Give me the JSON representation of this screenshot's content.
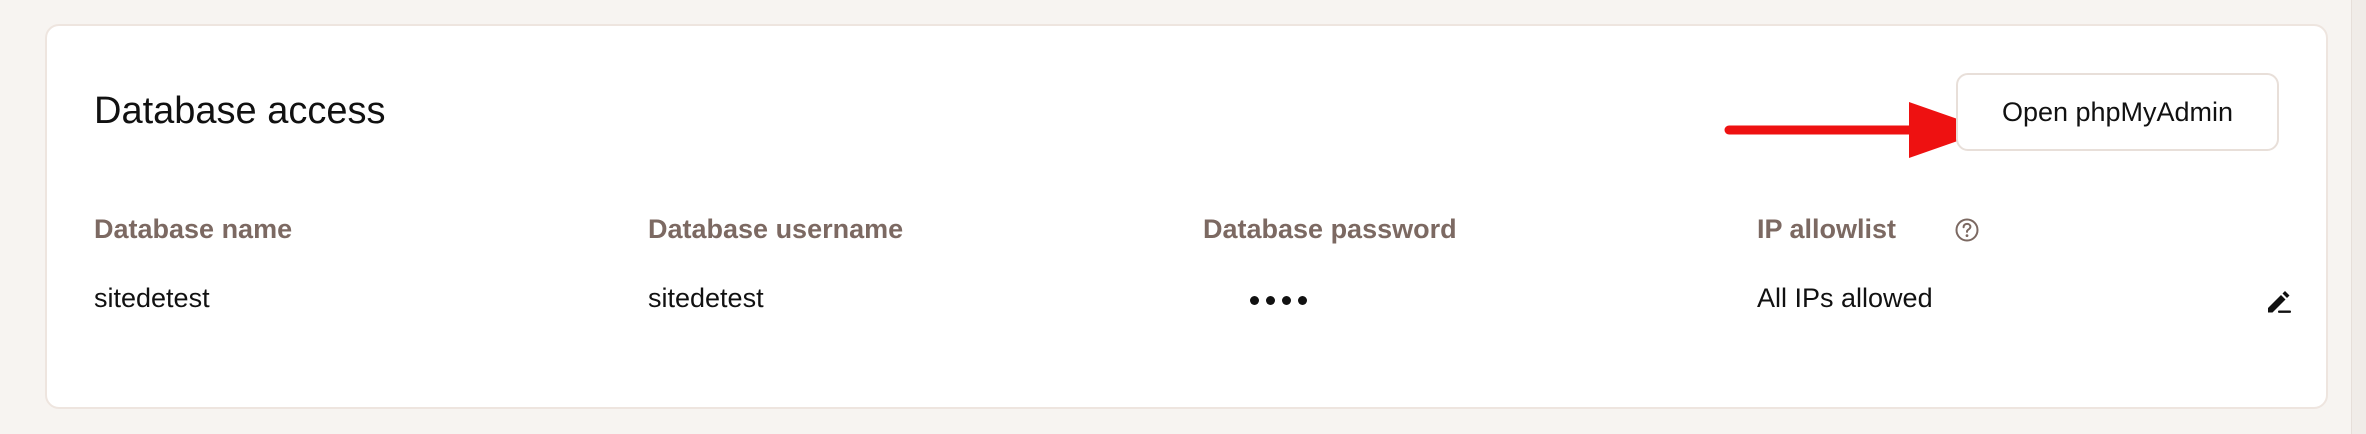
{
  "section": {
    "title": "Database access",
    "open_button_label": "Open phpMyAdmin"
  },
  "columns": {
    "db_name": "Database name",
    "db_username": "Database username",
    "db_password": "Database password",
    "ip_allowlist": "IP allowlist"
  },
  "row": {
    "db_name": "sitedetest",
    "db_username": "sitedetest",
    "password_masked_length": 4,
    "ip_allowlist": "All IPs allowed"
  },
  "icons": {
    "help": "question-circle-icon",
    "edit": "pencil-edit-icon",
    "annotation": "red-arrow"
  },
  "colors": {
    "background": "#f7f4f1",
    "card_background": "#ffffff",
    "card_border": "#eee5df",
    "header_text": "#7c6962",
    "body_text": "#111111",
    "annotation_arrow": "#ee1111"
  }
}
